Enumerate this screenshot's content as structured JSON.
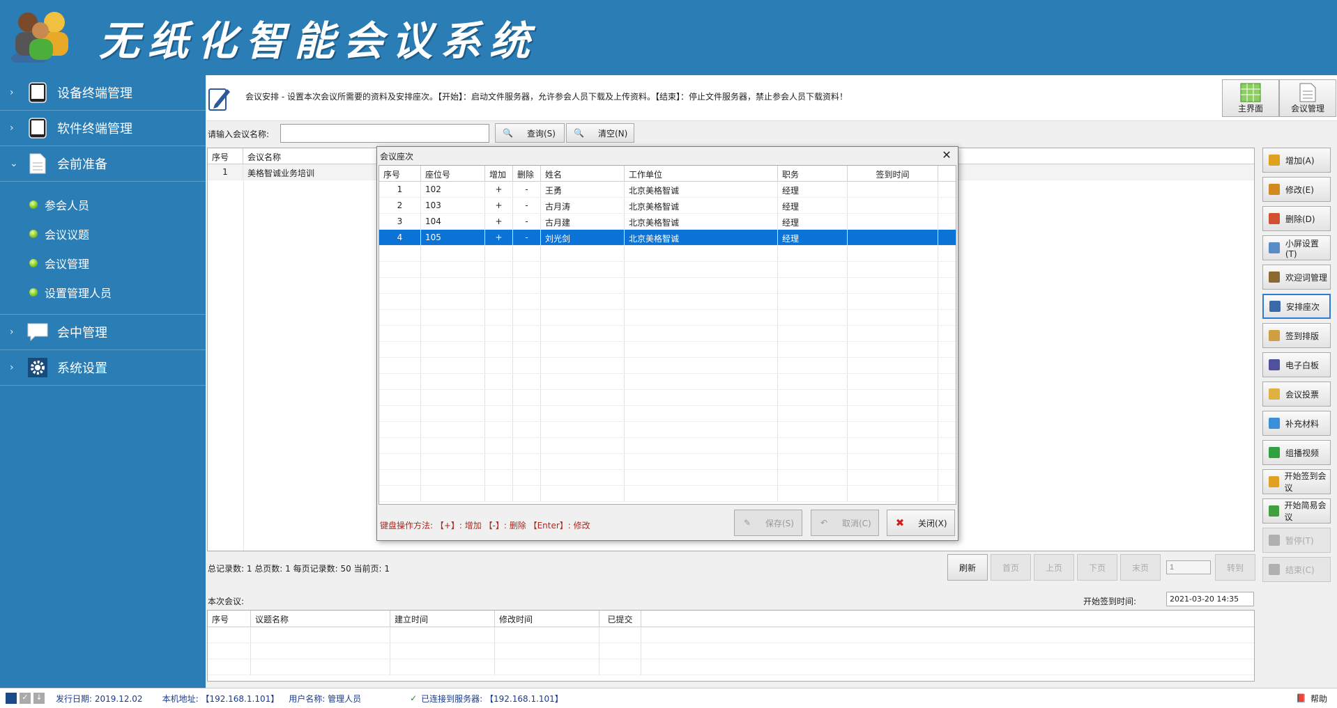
{
  "app_title": "无纸化智能会议系统",
  "sidebar": {
    "groups": [
      {
        "label": "设备终端管理",
        "icon": "tablet-icon"
      },
      {
        "label": "软件终端管理",
        "icon": "tablet-icon"
      },
      {
        "label": "会前准备",
        "icon": "document-icon",
        "expanded": true,
        "items": [
          "参会人员",
          "会议议题",
          "会议管理",
          "设置管理人员"
        ]
      },
      {
        "label": "会中管理",
        "icon": "chat-bubble-icon"
      },
      {
        "label": "系统设置",
        "icon": "gear-icon"
      }
    ]
  },
  "infobar": {
    "text": "会议安排 - 设置本次会议所需要的资料及安排座次。【开始】：启动文件服务器，允许参会人员下载及上传资料。【结束】：停止文件服务器，禁止参会人员下载资料！",
    "home_label": "主界面",
    "meeting_mgmt_label": "会议管理"
  },
  "search": {
    "label": "请输入会议名称:",
    "value": "",
    "query_label": "查询(S)",
    "clear_label": "清空(N)"
  },
  "meeting_table": {
    "headers": [
      "序号",
      "会议名称"
    ],
    "rows": [
      [
        "1",
        "美格智诚业务培训"
      ]
    ]
  },
  "paging": {
    "summary": "总记录数: 1 总页数: 1 每页记录数: 50 当前页: 1",
    "refresh": "刷新",
    "first": "首页",
    "prev": "上页",
    "next": "下页",
    "last": "末页",
    "page_value": "1",
    "goto": "转到"
  },
  "current_meeting": {
    "label": "本次会议:",
    "sign_time_label": "开始签到时间:",
    "sign_time_value": "2021-03-20 14:35",
    "headers": [
      "序号",
      "议题名称",
      "建立时间",
      "修改时间",
      "已提交"
    ]
  },
  "right_buttons": [
    {
      "label": "增加(A)",
      "icon": "add-icon",
      "color": "#e0a020"
    },
    {
      "label": "修改(E)",
      "icon": "edit-icon",
      "color": "#d08a20"
    },
    {
      "label": "删除(D)",
      "icon": "delete-icon",
      "color": "#d05030"
    },
    {
      "label": "小屏设置(T)",
      "icon": "screen-icon",
      "color": "#5a8ac8"
    },
    {
      "label": "欢迎词管理",
      "icon": "welcome-icon",
      "color": "#8a6a30"
    },
    {
      "label": "安排座次",
      "icon": "seat-icon",
      "color": "#3a6aaa",
      "selected": true
    },
    {
      "label": "签到排版",
      "icon": "signin-layout-icon",
      "color": "#d0a040"
    },
    {
      "label": "电子白板",
      "icon": "whiteboard-icon",
      "color": "#5050a0"
    },
    {
      "label": "会议投票",
      "icon": "vote-icon",
      "color": "#e0b040"
    },
    {
      "label": "补充材料",
      "icon": "material-icon",
      "color": "#3a90d8"
    },
    {
      "label": "组播视频",
      "icon": "video-icon",
      "color": "#30a040"
    },
    {
      "label": "开始签到会议",
      "icon": "pencil-icon",
      "color": "#e0a020"
    },
    {
      "label": "开始简易会议",
      "icon": "doc-add-icon",
      "color": "#40a040"
    },
    {
      "label": "暂停(T)",
      "icon": "pause-icon",
      "color": "#b0b0b0",
      "disabled": true
    },
    {
      "label": "结束(C)",
      "icon": "stop-icon",
      "color": "#b0b0b0",
      "disabled": true
    }
  ],
  "dialog": {
    "title": "会议座次",
    "headers": [
      "序号",
      "座位号",
      "增加",
      "删除",
      "姓名",
      "工作单位",
      "职务",
      "签到时间"
    ],
    "rows": [
      [
        "1",
        "102",
        "+",
        "-",
        "王勇",
        "北京美格智诚",
        "经理",
        ""
      ],
      [
        "2",
        "103",
        "+",
        "-",
        "古月涛",
        "北京美格智诚",
        "经理",
        ""
      ],
      [
        "3",
        "104",
        "+",
        "-",
        "古月建",
        "北京美格智诚",
        "经理",
        ""
      ],
      [
        "4",
        "105",
        "+",
        "-",
        "刘光剑",
        "北京美格智诚",
        "经理",
        ""
      ]
    ],
    "selected_row": 3,
    "hint": "键盘操作方法: 【+】: 增加 【-】: 删除 【Enter】: 修改",
    "save_label": "保存(S)",
    "cancel_label": "取消(C)",
    "close_label": "关闭(X)"
  },
  "status": {
    "release_date": "发行日期: 2019.12.02",
    "local_address": "本机地址: 【192.168.1.101】",
    "user_name": "用户名称: 管理人员",
    "server": "已连接到服务器: 【192.168.1.101】",
    "help": "帮助"
  }
}
